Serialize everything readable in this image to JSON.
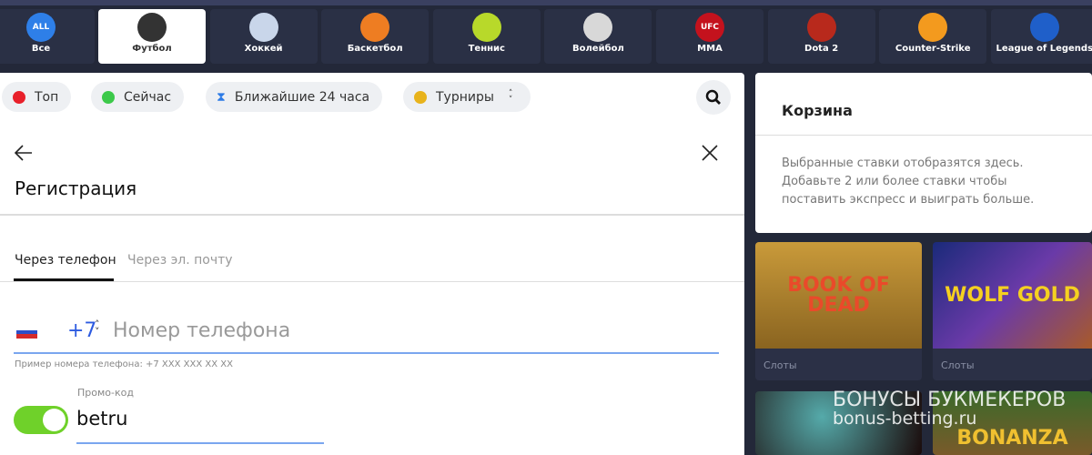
{
  "sports_tabs": [
    {
      "label": "Все",
      "icon": "all-icon",
      "badge": "ALL",
      "color": "#2e7fe8"
    },
    {
      "label": "Футбол",
      "icon": "soccer-ball-icon",
      "color": "#333333",
      "active": true
    },
    {
      "label": "Хоккей",
      "icon": "hockey-icon",
      "color": "#c9d6ea"
    },
    {
      "label": "Баскетбол",
      "icon": "basketball-icon",
      "color": "#ee7d22"
    },
    {
      "label": "Теннис",
      "icon": "tennis-ball-icon",
      "color": "#b8d92a"
    },
    {
      "label": "Волейбол",
      "icon": "volleyball-icon",
      "color": "#d8d8d8"
    },
    {
      "label": "MMA",
      "icon": "ufc-icon",
      "badge": "UFC",
      "color": "#c4121d"
    },
    {
      "label": "Dota 2",
      "icon": "dota-icon",
      "color": "#b8291c"
    },
    {
      "label": "Counter-Strike",
      "icon": "counter-strike-icon",
      "color": "#f39a1e"
    },
    {
      "label": "League of Legends",
      "icon": "lol-icon",
      "color": "#1f5fc9"
    }
  ],
  "filters": [
    {
      "label": "Топ",
      "icon": "fire-icon",
      "color": "#e8202a"
    },
    {
      "label": "Сейчас",
      "icon": "live-dot-icon",
      "color": "#3cc94a"
    },
    {
      "label": "Ближайшие 24 часа",
      "icon": "hourglass-icon",
      "color": "#2d7be6"
    },
    {
      "label": "Турниры",
      "icon": "globe-icon",
      "color": "#e8b31c"
    }
  ],
  "registration": {
    "title": "Регистрация",
    "tabs": [
      "Через телефон",
      "Через эл. почту"
    ],
    "country_code": "+7",
    "phone_placeholder": "Номер телефона",
    "phone_hint": "Пример номера телефона: +7 XXX XXX XX XX",
    "promo_label": "Промо-код",
    "promo_value": "betru",
    "promo_enabled": true
  },
  "cart": {
    "title": "Корзина",
    "message": "Выбранные ставки отобразятся здесь. Добавьте 2 или более ставки чтобы поставить экспресс и выиграть больше."
  },
  "slots": [
    {
      "title": "BOOK OF DEAD",
      "category": "Слоты"
    },
    {
      "title": "WOLF GOLD",
      "category": "Слоты"
    },
    {
      "title": "",
      "category": ""
    },
    {
      "title": "BONANZA",
      "category": ""
    }
  ],
  "watermark": {
    "line1": "БОНУСЫ БУКМЕКЕРОВ",
    "line2": "bonus-betting.ru"
  },
  "colors": {
    "accent": "#2d6be6",
    "toggle": "#6fd12a",
    "dark_bg": "#232839"
  }
}
